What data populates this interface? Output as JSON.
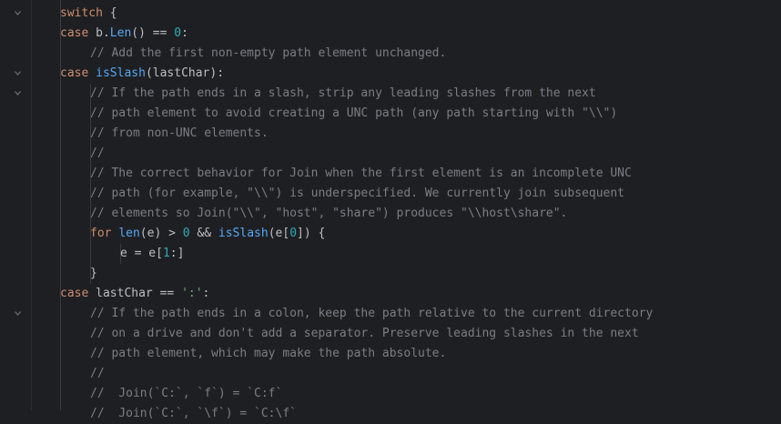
{
  "colors": {
    "background": "#1e1f22",
    "keyword": "#cf8e6d",
    "function": "#56a8f5",
    "number": "#2aacb8",
    "string": "#6aab73",
    "comment": "#7a7e85",
    "text": "#bcbec4"
  },
  "lines": [
    {
      "fold": true,
      "indent": 2,
      "tokens": [
        {
          "t": "kw",
          "v": "switch"
        },
        {
          "t": "op",
          "v": " {"
        }
      ]
    },
    {
      "fold": false,
      "indent": 2,
      "tokens": [
        {
          "t": "kw",
          "v": "case"
        },
        {
          "t": "op",
          "v": " b."
        },
        {
          "t": "fn",
          "v": "Len"
        },
        {
          "t": "op",
          "v": "() == "
        },
        {
          "t": "num",
          "v": "0"
        },
        {
          "t": "op",
          "v": ":"
        }
      ]
    },
    {
      "fold": false,
      "indent": 3,
      "tokens": [
        {
          "t": "cm",
          "v": "// Add the first non-empty path element unchanged."
        }
      ]
    },
    {
      "fold": true,
      "indent": 2,
      "tokens": [
        {
          "t": "kw",
          "v": "case"
        },
        {
          "t": "op",
          "v": " "
        },
        {
          "t": "fn",
          "v": "isSlash"
        },
        {
          "t": "op",
          "v": "(lastChar):"
        }
      ]
    },
    {
      "fold": true,
      "indent": 3,
      "tokens": [
        {
          "t": "cm",
          "v": "// If the path ends in a slash, strip any leading slashes from the next"
        }
      ]
    },
    {
      "fold": false,
      "indent": 3,
      "tokens": [
        {
          "t": "cm",
          "v": "// path element to avoid creating a UNC path (any path starting with \"\\\\\")"
        }
      ]
    },
    {
      "fold": false,
      "indent": 3,
      "tokens": [
        {
          "t": "cm",
          "v": "// from non-UNC elements."
        }
      ]
    },
    {
      "fold": false,
      "indent": 3,
      "tokens": [
        {
          "t": "cm",
          "v": "//"
        }
      ]
    },
    {
      "fold": false,
      "indent": 3,
      "tokens": [
        {
          "t": "cm",
          "v": "// The correct behavior for Join when the first element is an incomplete UNC"
        }
      ]
    },
    {
      "fold": false,
      "indent": 3,
      "tokens": [
        {
          "t": "cm",
          "v": "// path (for example, \"\\\\\") is underspecified. We currently join subsequent"
        }
      ]
    },
    {
      "fold": false,
      "indent": 3,
      "tokens": [
        {
          "t": "cm",
          "v": "// elements so Join(\"\\\\\", \"host\", \"share\") produces \"\\\\host\\share\"."
        }
      ]
    },
    {
      "fold": false,
      "indent": 3,
      "tokens": [
        {
          "t": "kw",
          "v": "for"
        },
        {
          "t": "op",
          "v": " "
        },
        {
          "t": "fn",
          "v": "len"
        },
        {
          "t": "op",
          "v": "(e) > "
        },
        {
          "t": "num",
          "v": "0"
        },
        {
          "t": "op",
          "v": " && "
        },
        {
          "t": "fn",
          "v": "isSlash"
        },
        {
          "t": "op",
          "v": "(e["
        },
        {
          "t": "num",
          "v": "0"
        },
        {
          "t": "op",
          "v": "]) {"
        }
      ]
    },
    {
      "fold": false,
      "indent": 4,
      "tokens": [
        {
          "t": "op",
          "v": "e = e["
        },
        {
          "t": "num",
          "v": "1"
        },
        {
          "t": "op",
          "v": ":]"
        }
      ]
    },
    {
      "fold": false,
      "indent": 3,
      "tokens": [
        {
          "t": "op",
          "v": "}"
        }
      ]
    },
    {
      "fold": false,
      "indent": 2,
      "tokens": [
        {
          "t": "kw",
          "v": "case"
        },
        {
          "t": "op",
          "v": " lastChar == "
        },
        {
          "t": "str",
          "v": "':'"
        },
        {
          "t": "op",
          "v": ":"
        }
      ]
    },
    {
      "fold": true,
      "indent": 3,
      "tokens": [
        {
          "t": "cm",
          "v": "// If the path ends in a colon, keep the path relative to the current directory"
        }
      ]
    },
    {
      "fold": false,
      "indent": 3,
      "tokens": [
        {
          "t": "cm",
          "v": "// on a drive and don't add a separator. Preserve leading slashes in the next"
        }
      ]
    },
    {
      "fold": false,
      "indent": 3,
      "tokens": [
        {
          "t": "cm",
          "v": "// path element, which may make the path absolute."
        }
      ]
    },
    {
      "fold": false,
      "indent": 3,
      "tokens": [
        {
          "t": "cm",
          "v": "//"
        }
      ]
    },
    {
      "fold": false,
      "indent": 3,
      "tokens": [
        {
          "t": "cm",
          "v": "//  Join(`C:`, `f`) = `C:f`"
        }
      ]
    },
    {
      "fold": false,
      "indent": 3,
      "tokens": [
        {
          "t": "cm",
          "v": "//  Join(`C:`, `\\f`) = `C:\\f`"
        }
      ]
    }
  ]
}
